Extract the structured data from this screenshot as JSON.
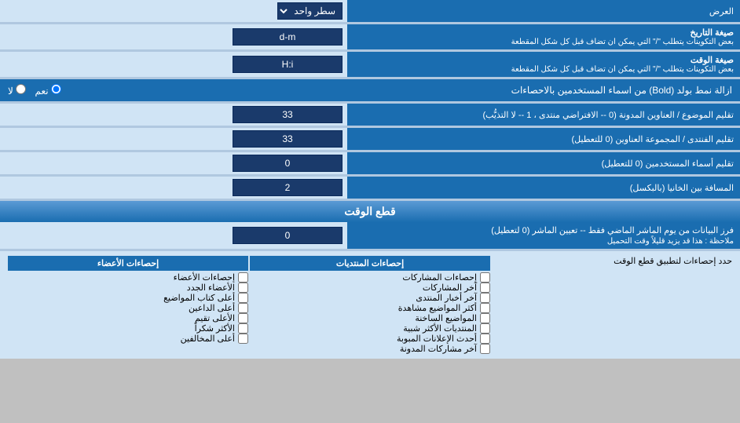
{
  "title": "العرض",
  "rows": [
    {
      "id": "single-line",
      "label": "العرض",
      "type": "dropdown",
      "value": "سطر واحد"
    },
    {
      "id": "date-format",
      "label": "صيغة التاريخ",
      "sublabel": "بعض التكوينات يتطلب \"/\" التي يمكن ان تضاف قبل كل شكل المقطعة",
      "type": "text",
      "value": "d-m"
    },
    {
      "id": "time-format",
      "label": "صيغة الوقت",
      "sublabel": "بعض التكوينات يتطلب \"/\" التي يمكن ان تضاف قبل كل شكل المقطعة",
      "type": "text",
      "value": "H:i"
    },
    {
      "id": "bold-remove",
      "label": "ازالة نمط بولد (Bold) من اسماء المستخدمين بالاحصاءات",
      "type": "radio",
      "options": [
        "نعم",
        "لا"
      ],
      "selected": "نعم"
    },
    {
      "id": "topic-count",
      "label": "تقليم الموضوع / العناوين المدونة (0 -- الافتراضي منتدى ، 1 -- لا التذيُّب)",
      "type": "text",
      "value": "33"
    },
    {
      "id": "forum-count",
      "label": "تقليم الفنتدى / المجموعة العناوين (0 للتعطيل)",
      "type": "text",
      "value": "33"
    },
    {
      "id": "username-count",
      "label": "تقليم أسماء المستخدمين (0 للتعطيل)",
      "type": "text",
      "value": "0"
    },
    {
      "id": "gap",
      "label": "المسافة بين الخانيا (بالبكسل)",
      "type": "text",
      "value": "2"
    }
  ],
  "time_cut_section": {
    "header": "قطع الوقت",
    "row": {
      "label_main": "فرز البيانات من يوم الماشر الماضي فقط -- تعيين الماشر (0 لتعطيل)",
      "label_note": "ملاحظة : هذا قد يزيد قليلاً وقت التحميل",
      "value": "0",
      "limit_label": "حدد إحصاءات لتطبيق قطع الوقت"
    }
  },
  "stats_columns": [
    {
      "header": "إحصاءات الأعضاء",
      "items": [
        {
          "label": "إحصاءات الأعضاء",
          "checked": false
        },
        {
          "label": "الأعضاء الجدد",
          "checked": false
        },
        {
          "label": "أعلى كتاب المواضيع",
          "checked": false
        },
        {
          "label": "أعلى الداعين",
          "checked": false
        },
        {
          "label": "الأعلى تقيم",
          "checked": false
        },
        {
          "label": "الأكثر شكراً",
          "checked": false
        },
        {
          "label": "أعلى المخالفين",
          "checked": false
        }
      ]
    },
    {
      "header": "إحصاءات المنتديات",
      "items": [
        {
          "label": "إحصاءات المشاركات",
          "checked": false
        },
        {
          "label": "آخر المشاركات",
          "checked": false
        },
        {
          "label": "آخر أخبار المنتدى",
          "checked": false
        },
        {
          "label": "أكثر المواضيع مشاهدة",
          "checked": false
        },
        {
          "label": "المواضيع الساخنة",
          "checked": false
        },
        {
          "label": "المنتديات الأكثر شبية",
          "checked": false
        },
        {
          "label": "أحدث الإعلانات المبوبة",
          "checked": false
        },
        {
          "label": "آخر مشاركات المدونة",
          "checked": false
        }
      ]
    }
  ]
}
